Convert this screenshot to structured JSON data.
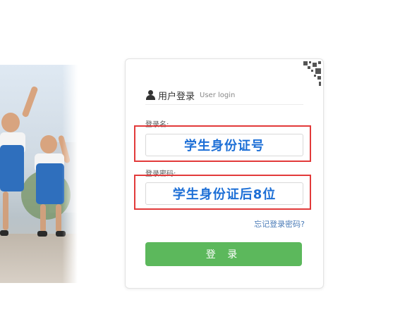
{
  "header": {
    "title": "用户登录",
    "subtitle": "User login"
  },
  "username": {
    "label": "登录名:",
    "value": "学生身份证号"
  },
  "password": {
    "label": "登录密码:",
    "value": "学生身份证后8位"
  },
  "forgot_link": "忘记登录密码?",
  "login_button": "登 录",
  "colors": {
    "accent": "#1d6fd6",
    "button": "#5cb85c",
    "highlight": "#e23a3a"
  },
  "icons": [
    "user-icon",
    "qr-code-icon"
  ]
}
